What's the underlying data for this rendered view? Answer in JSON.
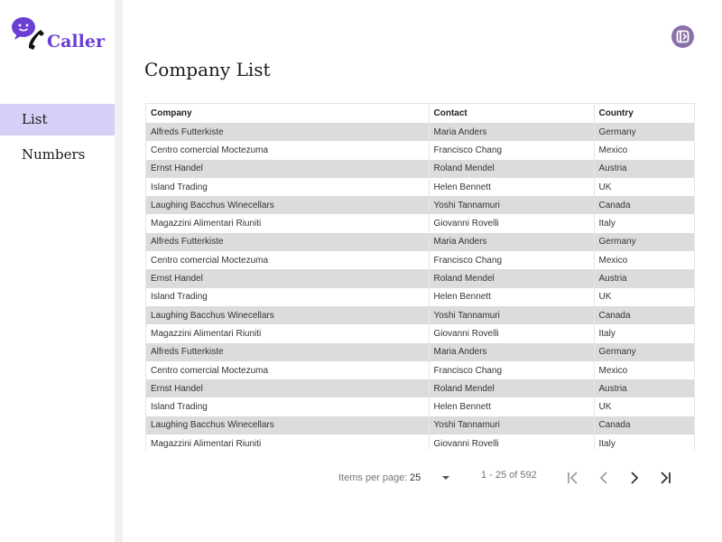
{
  "app": {
    "brand": "Caller",
    "brand_color": "#6b3fd4",
    "accent_color": "#d8cff8"
  },
  "sidebar": {
    "items": [
      {
        "label": "List",
        "active": true
      },
      {
        "label": "Numbers",
        "active": false
      }
    ]
  },
  "header": {
    "logout_icon": "logout-icon"
  },
  "main": {
    "title": "Company List"
  },
  "table": {
    "columns": [
      "Company",
      "Contact",
      "Country"
    ],
    "rows": [
      [
        "Alfreds Futterkiste",
        "Maria Anders",
        "Germany"
      ],
      [
        "Centro comercial Moctezuma",
        "Francisco Chang",
        "Mexico"
      ],
      [
        "Ernst Handel",
        "Roland Mendel",
        "Austria"
      ],
      [
        "Island Trading",
        "Helen Bennett",
        "UK"
      ],
      [
        "Laughing Bacchus Winecellars",
        "Yoshi Tannamuri",
        "Canada"
      ],
      [
        "Magazzini Alimentari Riuniti",
        "Giovanni Rovelli",
        "Italy"
      ],
      [
        "Alfreds Futterkiste",
        "Maria Anders",
        "Germany"
      ],
      [
        "Centro comercial Moctezuma",
        "Francisco Chang",
        "Mexico"
      ],
      [
        "Ernst Handel",
        "Roland Mendel",
        "Austria"
      ],
      [
        "Island Trading",
        "Helen Bennett",
        "UK"
      ],
      [
        "Laughing Bacchus Winecellars",
        "Yoshi Tannamuri",
        "Canada"
      ],
      [
        "Magazzini Alimentari Riuniti",
        "Giovanni Rovelli",
        "Italy"
      ],
      [
        "Alfreds Futterkiste",
        "Maria Anders",
        "Germany"
      ],
      [
        "Centro comercial Moctezuma",
        "Francisco Chang",
        "Mexico"
      ],
      [
        "Ernst Handel",
        "Roland Mendel",
        "Austria"
      ],
      [
        "Island Trading",
        "Helen Bennett",
        "UK"
      ],
      [
        "Laughing Bacchus Winecellars",
        "Yoshi Tannamuri",
        "Canada"
      ],
      [
        "Magazzini Alimentari Riuniti",
        "Giovanni Rovelli",
        "Italy"
      ]
    ]
  },
  "paginator": {
    "items_per_page_label": "Items per page:",
    "page_size": "25",
    "range_label": "1 - 25 of 592",
    "icons": [
      "first-page-icon",
      "previous-page-icon",
      "next-page-icon",
      "last-page-icon"
    ]
  }
}
